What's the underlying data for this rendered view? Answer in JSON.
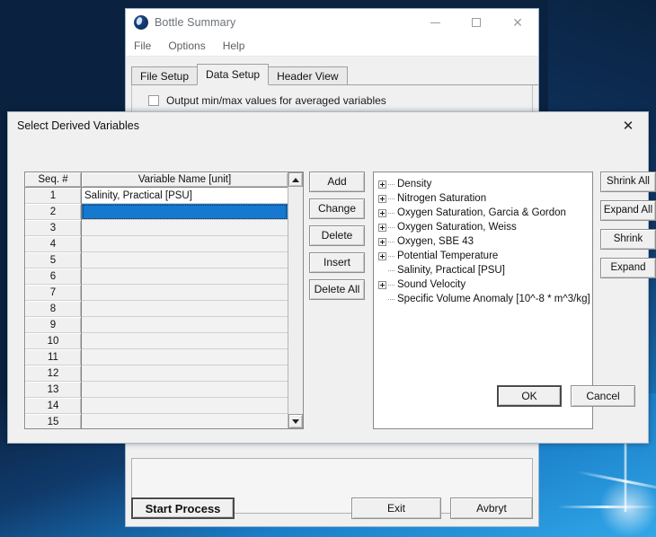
{
  "desktop": {
    "bg_color": "#0a2240",
    "accent": "#1778cf"
  },
  "app_window": {
    "title": "Bottle Summary",
    "icon": "water-drop-icon",
    "controls": {
      "minimize": "–",
      "maximize": "□",
      "close": "✕"
    },
    "menu": [
      "File",
      "Options",
      "Help"
    ],
    "tabs": [
      {
        "label": "File Setup",
        "active": false
      },
      {
        "label": "Data Setup",
        "active": true
      },
      {
        "label": "Header View",
        "active": false
      }
    ],
    "checkbox": {
      "label": "Output min/max values for averaged variables",
      "checked": false
    },
    "bottom_buttons": [
      {
        "label": "Start Process",
        "name": "start-process-button"
      },
      {
        "label": "Exit",
        "name": "exit-button"
      },
      {
        "label": "Avbryt",
        "name": "avbryt-button"
      }
    ]
  },
  "dialog": {
    "title": "Select Derived Variables",
    "close_glyph": "✕",
    "grid": {
      "headers": [
        "Seq. #",
        "Variable Name [unit]"
      ],
      "rows": [
        {
          "seq": "1",
          "name": "Salinity, Practical [PSU]",
          "state": "filled"
        },
        {
          "seq": "2",
          "name": "",
          "state": "selected"
        },
        {
          "seq": "3",
          "name": "",
          "state": "empty"
        },
        {
          "seq": "4",
          "name": "",
          "state": "empty"
        },
        {
          "seq": "5",
          "name": "",
          "state": "empty"
        },
        {
          "seq": "6",
          "name": "",
          "state": "empty"
        },
        {
          "seq": "7",
          "name": "",
          "state": "empty"
        },
        {
          "seq": "8",
          "name": "",
          "state": "empty"
        },
        {
          "seq": "9",
          "name": "",
          "state": "empty"
        },
        {
          "seq": "10",
          "name": "",
          "state": "empty"
        },
        {
          "seq": "11",
          "name": "",
          "state": "empty"
        },
        {
          "seq": "12",
          "name": "",
          "state": "empty"
        },
        {
          "seq": "13",
          "name": "",
          "state": "empty"
        },
        {
          "seq": "14",
          "name": "",
          "state": "empty"
        },
        {
          "seq": "15",
          "name": "",
          "state": "empty"
        }
      ],
      "scrollbar": {
        "up": "scroll-up-arrow",
        "down": "scroll-down-arrow"
      }
    },
    "middle_buttons": [
      "Add",
      "Change",
      "Delete",
      "Insert",
      "Delete All"
    ],
    "tree": [
      {
        "label": "Density",
        "expandable": true
      },
      {
        "label": "Nitrogen Saturation",
        "expandable": true
      },
      {
        "label": "Oxygen Saturation, Garcia & Gordon",
        "expandable": true
      },
      {
        "label": "Oxygen Saturation, Weiss",
        "expandable": true
      },
      {
        "label": "Oxygen, SBE 43",
        "expandable": true
      },
      {
        "label": "Potential Temperature",
        "expandable": true
      },
      {
        "label": "Salinity, Practical [PSU]",
        "expandable": false
      },
      {
        "label": "Sound Velocity",
        "expandable": true
      },
      {
        "label": "Specific Volume Anomaly [10^-8 * m^3/kg]",
        "expandable": false
      }
    ],
    "right_buttons": [
      "Shrink All",
      "Expand All",
      "Shrink",
      "Expand"
    ],
    "ok_label": "OK",
    "cancel_label": "Cancel"
  }
}
